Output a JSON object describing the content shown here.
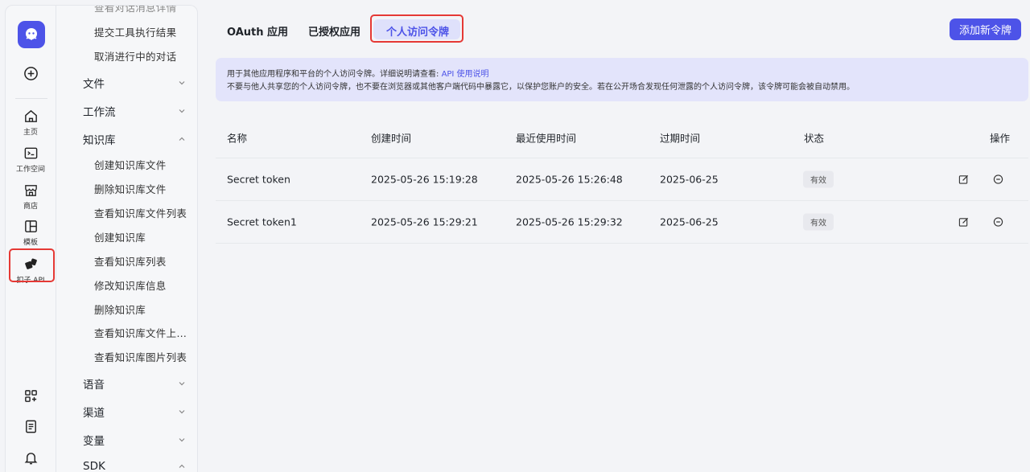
{
  "rail": {
    "items": [
      {
        "label": "主页",
        "icon": "home-icon"
      },
      {
        "label": "工作空间",
        "icon": "terminal-icon"
      },
      {
        "label": "商店",
        "icon": "store-icon"
      },
      {
        "label": "模板",
        "icon": "template-icon"
      },
      {
        "label": "扣子 API",
        "icon": "api-icon"
      }
    ],
    "bottom_icons": [
      "apps-icon",
      "document-icon",
      "bell-icon"
    ]
  },
  "sidebar": {
    "truncated_top": "查看对话消息详情",
    "chat_items": [
      "提交工具执行结果",
      "取消进行中的对话"
    ],
    "groups": {
      "file": "文件",
      "workflow": "工作流",
      "knowledge": "知识库",
      "voice": "语音",
      "channel": "渠道",
      "variable": "变量",
      "sdk": "SDK"
    },
    "knowledge_items": [
      "创建知识库文件",
      "删除知识库文件",
      "查看知识库文件列表",
      "创建知识库",
      "查看知识库列表",
      "修改知识库信息",
      "删除知识库",
      "查看知识库文件上…",
      "查看知识库图片列表"
    ]
  },
  "tabs": [
    "OAuth 应用",
    "已授权应用",
    "个人访问令牌"
  ],
  "active_tab": "个人访问令牌",
  "add_button": "添加新令牌",
  "notice": {
    "line1_prefix": "用于其他应用程序和平台的个人访问令牌。详细说明请查看: ",
    "line1_link": "API 使用说明",
    "line2": "不要与他人共享您的个人访问令牌，也不要在浏览器或其他客户端代码中暴露它，以保护您账户的安全。若在公开场合发现任何泄露的个人访问令牌，该令牌可能会被自动禁用。"
  },
  "table": {
    "headers": {
      "name": "名称",
      "created": "创建时间",
      "last_used": "最近使用时间",
      "expires": "过期时间",
      "status": "状态",
      "actions": "操作"
    },
    "rows": [
      {
        "name": "Secret token",
        "created": "2025-05-26 15:19:28",
        "last_used": "2025-05-26 15:26:48",
        "expires": "2025-06-25",
        "status": "有效"
      },
      {
        "name": "Secret token1",
        "created": "2025-05-26 15:29:21",
        "last_used": "2025-05-26 15:29:32",
        "expires": "2025-06-25",
        "status": "有效"
      }
    ]
  },
  "colors": {
    "accent": "#4d53e8",
    "highlight": "#e53935",
    "notice_bg": "#e3e4fb",
    "tab_active_bg": "#dfe1fb"
  }
}
